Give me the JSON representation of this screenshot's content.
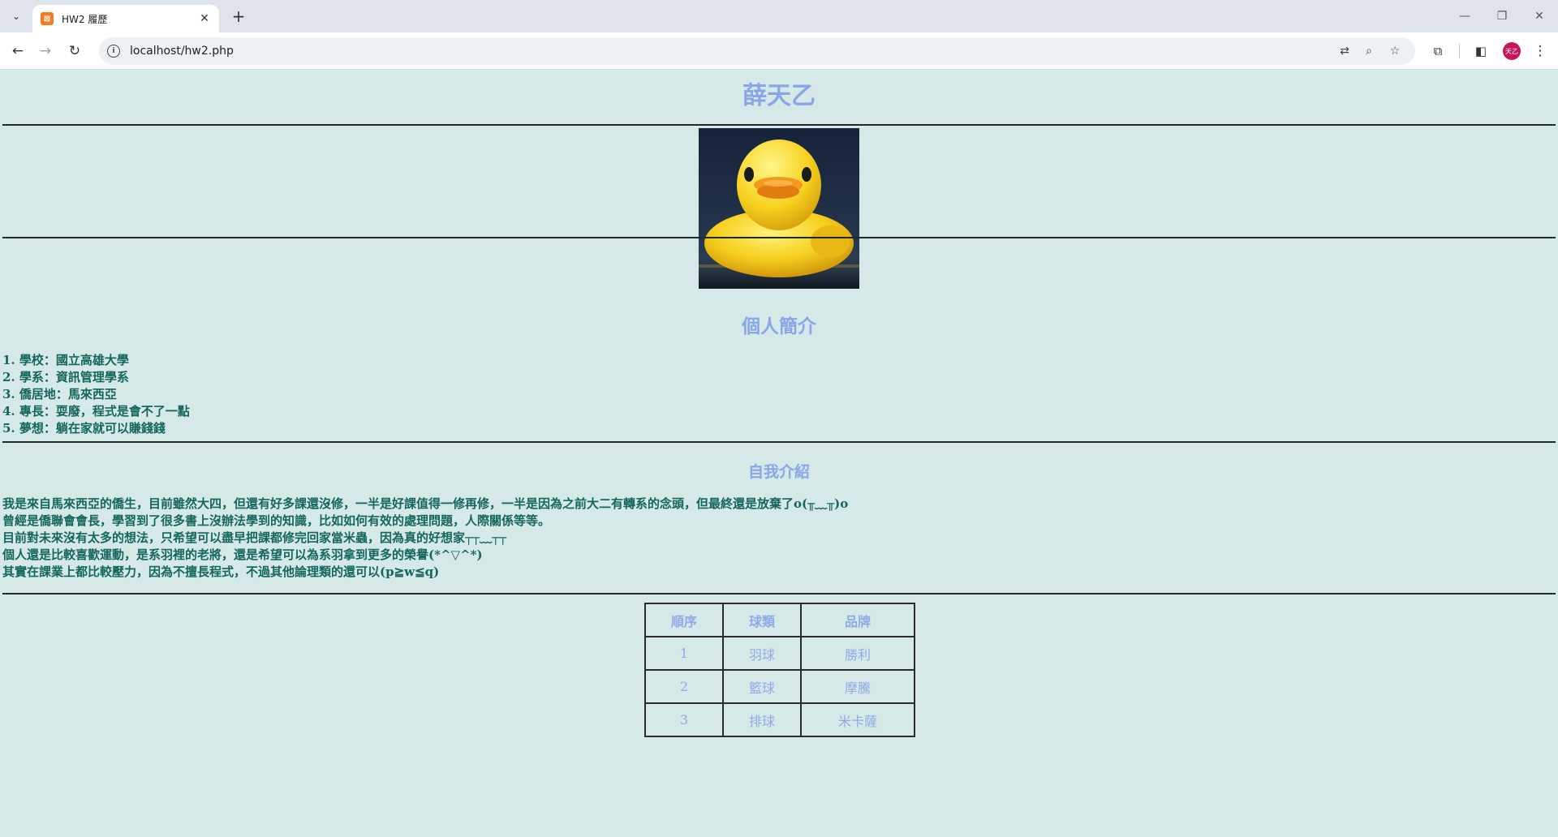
{
  "browser": {
    "tab_title": "HW2 履歷",
    "url": "localhost/hw2.php",
    "profile_initials": "天乙",
    "icons": {
      "tab_search": "chevron-down-icon",
      "tab_close": "close-icon",
      "new_tab": "plus-icon",
      "back": "back-arrow-icon",
      "forward": "forward-arrow-icon",
      "reload": "reload-icon",
      "site_info": "info-icon",
      "translate": "translate-icon",
      "zoom": "zoom-icon",
      "bookmark": "star-icon",
      "extensions": "puzzle-icon",
      "side_panel": "side-panel-icon",
      "menu": "kebab-menu-icon"
    }
  },
  "page": {
    "background_color": "#d4e9e8",
    "heading_color": "#8aa6e6",
    "text_color": "#16665e",
    "name": "薛天乙",
    "profile_heading": "個人簡介",
    "profile_items": [
      "1. 學校：國立高雄大學",
      "2. 學系：資訊管理學系",
      "3. 僑居地：馬來西亞",
      "4. 專長：耍廢，程式是會不了一點",
      "5. 夢想：躺在家就可以賺錢錢"
    ],
    "intro_heading": "自我介紹",
    "intro_lines": [
      "我是來自馬來西亞的僑生，目前雖然大四，但還有好多課還沒修，一半是好課值得一修再修，一半是因為之前大二有轉系的念頭，但最終還是放棄了o(╥﹏╥)o",
      "曾經是僑聯會會長，學習到了很多書上沒辦法學到的知識，比如如何有效的處理問題，人際關係等等。",
      "目前對未來沒有太多的想法，只希望可以盡早把課都修完回家當米蟲，因為真的好想家┬┬﹏┬┬",
      "個人還是比較喜歡運動，是系羽裡的老將，還是希望可以為系羽拿到更多的榮譽(*^▽^*)",
      "其實在課業上都比較壓力，因為不擅長程式，不過其他論理類的還可以(p≧w≦q)"
    ],
    "table": {
      "headers": [
        "順序",
        "球類",
        "品牌"
      ],
      "rows": [
        [
          "1",
          "羽球",
          "勝利"
        ],
        [
          "2",
          "籃球",
          "摩騰"
        ],
        [
          "3",
          "排球",
          "米卡薩"
        ]
      ]
    }
  }
}
